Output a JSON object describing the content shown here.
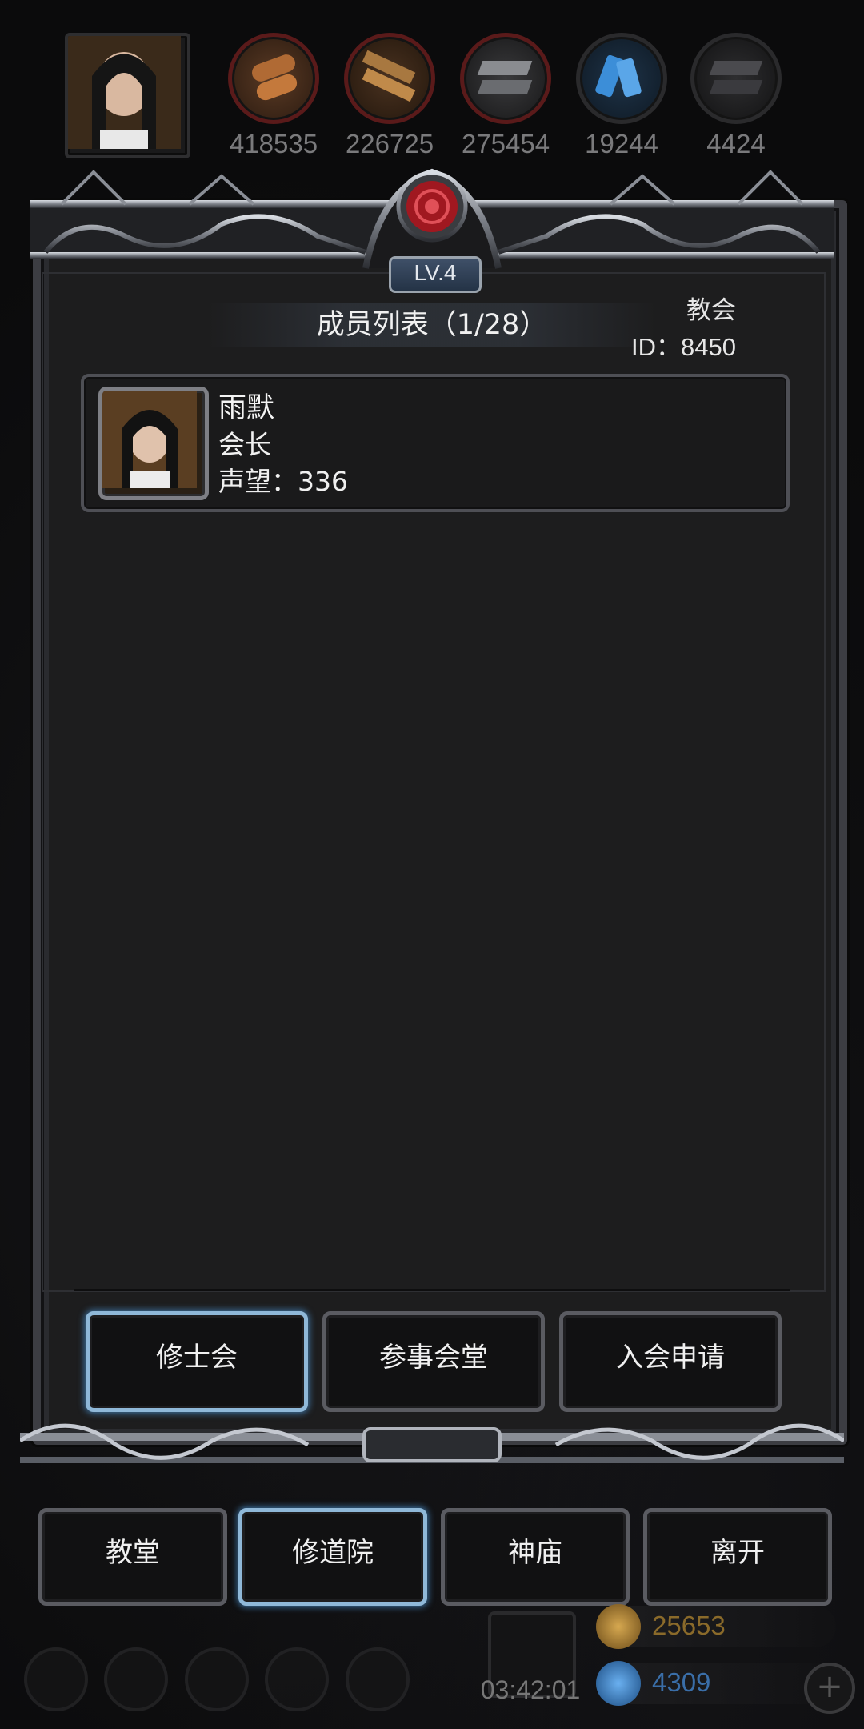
{
  "resources": [
    {
      "icon": "wood-logs-icon",
      "value": "418535"
    },
    {
      "icon": "lumber-planks-icon",
      "value": "226725"
    },
    {
      "icon": "iron-ingots-icon",
      "value": "275454"
    },
    {
      "icon": "blue-crystal-icon",
      "value": "19244"
    },
    {
      "icon": "dark-metal-icon",
      "value": "4424"
    }
  ],
  "guild": {
    "level": "LV.4",
    "list_title": "成员列表（1/28）",
    "type": "教会",
    "id_text": "ID：8450"
  },
  "members": [
    {
      "name": "雨默",
      "role": "会长",
      "reputation": "声望：336"
    }
  ],
  "sub_tabs": [
    {
      "label": "修士会",
      "active": true
    },
    {
      "label": "参事会堂",
      "active": false
    },
    {
      "label": "入会申请",
      "active": false
    }
  ],
  "nav": [
    {
      "label": "教堂",
      "active": false
    },
    {
      "label": "修道院",
      "active": true
    },
    {
      "label": "神庙",
      "active": false
    },
    {
      "label": "离开",
      "active": false
    }
  ],
  "footer": {
    "timer": "03:42:01",
    "gold": "25653",
    "gems": "4309"
  },
  "colors": {
    "accent_glow": "#8fb8d8",
    "gold": "#b08a3a",
    "gem": "#3b7fc4"
  }
}
